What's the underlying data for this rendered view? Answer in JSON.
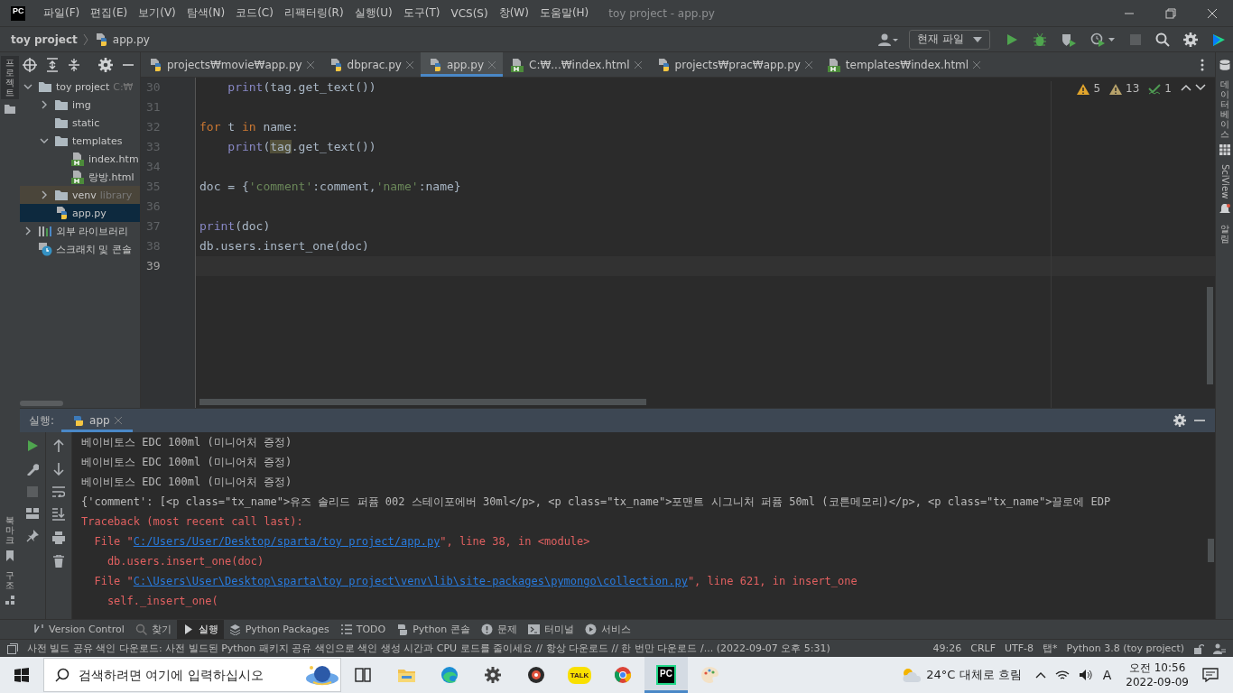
{
  "window": {
    "logo": "PC",
    "menu": [
      "파일(F)",
      "편집(E)",
      "보기(V)",
      "탐색(N)",
      "코드(C)",
      "리팩터링(R)",
      "실행(U)",
      "도구(T)",
      "VCS(S)",
      "창(W)",
      "도움말(H)"
    ],
    "title": "toy project - app.py"
  },
  "navbar": {
    "breadcrumb": [
      "toy project",
      "app.py"
    ],
    "run_config": "현재 파일"
  },
  "side_labels": {
    "left_top": "프로젝트",
    "left_bottom": [
      "북마크",
      "구조"
    ],
    "right": [
      "데이터베이스",
      "SciView",
      "알림"
    ]
  },
  "project_tree": [
    {
      "label": "toy project",
      "hint": "C:₩",
      "kind": "folder",
      "expanded": true,
      "selected": false,
      "children": [
        {
          "label": "img",
          "kind": "folder",
          "expanded": false,
          "selected": false
        },
        {
          "label": "static",
          "kind": "folder",
          "selected": false
        },
        {
          "label": "templates",
          "kind": "folder",
          "expanded": true,
          "selected": false,
          "children": [
            {
              "label": "index.htm",
              "kind": "html",
              "selected": false
            },
            {
              "label": "랑방.html",
              "kind": "html",
              "selected": false
            }
          ]
        },
        {
          "label": "venv",
          "hint": "library",
          "kind": "folder",
          "expanded": false,
          "selected": false
        },
        {
          "label": "app.py",
          "kind": "python",
          "selected": true
        }
      ]
    },
    {
      "label": "외부 라이브러리",
      "kind": "library",
      "expanded": false,
      "selected": false
    },
    {
      "label": "스크래치 및 콘솔",
      "kind": "scratch",
      "selected": false
    }
  ],
  "editor_tabs": [
    {
      "label": "projects₩movie₩app.py",
      "kind": "python",
      "selected": false
    },
    {
      "label": "dbprac.py",
      "kind": "python",
      "selected": false
    },
    {
      "label": "app.py",
      "kind": "python",
      "selected": true
    },
    {
      "label": "C:₩...₩index.html",
      "kind": "html",
      "selected": false
    },
    {
      "label": "projects₩prac₩app.py",
      "kind": "python",
      "selected": false
    },
    {
      "label": "templates₩index.html",
      "kind": "html",
      "selected": false
    }
  ],
  "inspections": [
    {
      "kind": "warning",
      "count": "5"
    },
    {
      "kind": "weak",
      "count": "13"
    },
    {
      "kind": "typo",
      "count": "1"
    }
  ],
  "code_lines": [
    {
      "number": "30",
      "tokens": [
        {
          "text": "    print",
          "kind": "builtin"
        },
        {
          "text": "(tag.get_text())"
        }
      ]
    },
    {
      "number": "31"
    },
    {
      "number": "32",
      "tokens": [
        {
          "text": "for",
          "kind": "keyword"
        },
        {
          "text": " t "
        },
        {
          "text": "in",
          "kind": "keyword"
        },
        {
          "text": " name:"
        }
      ]
    },
    {
      "number": "33",
      "tokens": [
        {
          "text": "    print",
          "kind": "builtin"
        },
        {
          "text": "("
        },
        {
          "text": "tag",
          "kind": "highlight"
        },
        {
          "text": ".get_text())"
        }
      ]
    },
    {
      "number": "34"
    },
    {
      "number": "35",
      "tokens": [
        {
          "text": "doc = {"
        },
        {
          "text": "'comment'",
          "kind": "string"
        },
        {
          "text": ":comment,"
        },
        {
          "text": "'name'",
          "kind": "string"
        },
        {
          "text": ":name}"
        }
      ]
    },
    {
      "number": "36"
    },
    {
      "number": "37",
      "tokens": [
        {
          "text": "print",
          "kind": "builtin"
        },
        {
          "text": "(doc)"
        }
      ]
    },
    {
      "number": "38",
      "tokens": [
        {
          "text": "db.users.insert_one(doc)"
        }
      ]
    },
    {
      "number": "39",
      "current": true
    }
  ],
  "run": {
    "label": "실행:",
    "tabs": [
      {
        "label": "app",
        "selected": true
      }
    ],
    "console": [
      {
        "kind": "output",
        "segments": [
          {
            "text": "베이비토스 EDC 100ml (미니어처 증정)"
          }
        ]
      },
      {
        "kind": "output",
        "segments": [
          {
            "text": "베이비토스 EDC 100ml (미니어처 증정)"
          }
        ]
      },
      {
        "kind": "output",
        "segments": [
          {
            "text": "베이비토스 EDC 100ml (미니어처 증정)"
          }
        ]
      },
      {
        "kind": "output",
        "segments": [
          {
            "text": "{'comment': [<p class=\"tx_name\">유즈 솔리드 퍼퓸 002 스테이포에버 30ml</p>, <p class=\"tx_name\">포맨트 시그니처 퍼퓸 50ml (코튼메모리)</p>, <p class=\"tx_name\">끌로에 EDP"
          }
        ]
      },
      {
        "kind": "error",
        "segments": [
          {
            "text": "Traceback (most recent call last):"
          }
        ]
      },
      {
        "kind": "error",
        "segments": [
          {
            "text": "  File \""
          },
          {
            "text": "C:/Users/User/Desktop/sparta/toy project/app.py",
            "kind": "link"
          },
          {
            "text": "\", line 38, in <module>"
          }
        ]
      },
      {
        "kind": "error",
        "segments": [
          {
            "text": "    db.users.insert_one(doc)"
          }
        ]
      },
      {
        "kind": "error",
        "segments": [
          {
            "text": "  File \""
          },
          {
            "text": "C:\\Users\\User\\Desktop\\sparta\\toy project\\venv\\lib\\site-packages\\pymongo\\collection.py",
            "kind": "link"
          },
          {
            "text": "\", line 621, in insert_one"
          }
        ]
      },
      {
        "kind": "error",
        "segments": [
          {
            "text": "    self._insert_one("
          }
        ]
      }
    ]
  },
  "tool_tabs": [
    {
      "label": "Version Control",
      "kind": "vcs",
      "selected": false
    },
    {
      "label": "찾기",
      "kind": "find",
      "selected": false
    },
    {
      "label": "실행",
      "kind": "run",
      "selected": true
    },
    {
      "label": "Python Packages",
      "kind": "packages",
      "selected": false
    },
    {
      "label": "TODO",
      "kind": "todo",
      "selected": false
    },
    {
      "label": "Python 콘솔",
      "kind": "python",
      "selected": false
    },
    {
      "label": "문제",
      "kind": "problems",
      "selected": false
    },
    {
      "label": "터미널",
      "kind": "terminal",
      "selected": false
    },
    {
      "label": "서비스",
      "kind": "services",
      "selected": false
    }
  ],
  "status_bar": {
    "message": "사전 빌드 공유 색인 다운로드: 사전 빌드된 Python 패키지 공유 색인으로 색인 생성 시간과 CPU 로드를 줄이세요 // 항상 다운로드 // 한 번만 다운로드 /... (2022-09-07 오후 5:31)",
    "items": [
      "49:26",
      "CRLF",
      "UTF-8",
      "탭*",
      "Python 3.8 (toy project)"
    ]
  },
  "taskbar": {
    "search_placeholder": "검색하려면 여기에 입력하십시오",
    "apps": [
      {
        "kind": "taskview",
        "active": false
      },
      {
        "kind": "explorer",
        "active": false
      },
      {
        "kind": "edge",
        "active": false
      },
      {
        "kind": "settings",
        "active": false
      },
      {
        "kind": "music",
        "active": false
      },
      {
        "kind": "talk",
        "label": "TALK",
        "active": false
      },
      {
        "kind": "chrome",
        "active": false
      },
      {
        "kind": "pycharm",
        "label": "PC",
        "active": true
      },
      {
        "kind": "paint",
        "active": false
      }
    ],
    "weather": "24°C 대체로 흐림",
    "ime": "A",
    "time": "오전 10:56",
    "date": "2022-09-09"
  }
}
